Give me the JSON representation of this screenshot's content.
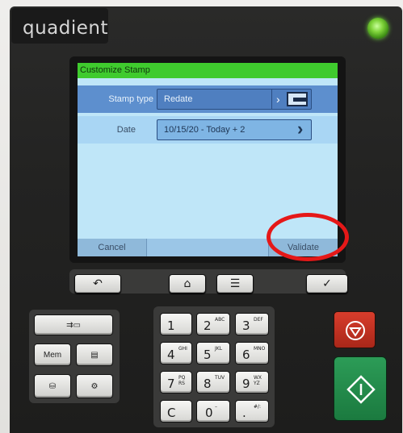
{
  "brand": {
    "logo_text": "quadient",
    "power_led_color": "#6fd23a"
  },
  "screen": {
    "title": "Customize Stamp",
    "title_bar_color": "#3fcb2e",
    "rows": [
      {
        "label": "Stamp type",
        "value": "Redate",
        "trailing_icon": "stamp-layout-icon"
      },
      {
        "label": "Date",
        "value": "10/15/20 - Today + 2",
        "trailing_icon": "chevron-right-icon"
      }
    ],
    "footer": {
      "cancel_label": "Cancel",
      "validate_label": "Validate"
    },
    "annotation_color": "#e51818"
  },
  "nav_buttons": [
    {
      "icon": "back-icon"
    },
    {
      "icon": "home-icon"
    },
    {
      "icon": "menu-icon"
    },
    {
      "icon": "checkmark-icon"
    }
  ],
  "side_keys": [
    {
      "icon": "feed-envelope-icon",
      "label": ""
    },
    {
      "icon": "",
      "label": "Mem"
    },
    {
      "icon": "card-slot-icon",
      "label": ""
    },
    {
      "icon": "coins-icon",
      "label": ""
    },
    {
      "icon": "postage-settings-icon",
      "label": ""
    }
  ],
  "keypad": [
    {
      "num": "1",
      "sub": ""
    },
    {
      "num": "2",
      "sub": "ABC"
    },
    {
      "num": "3",
      "sub": "DEF"
    },
    {
      "num": "4",
      "sub": "GHI"
    },
    {
      "num": "5",
      "sub": "JKL"
    },
    {
      "num": "6",
      "sub": "MNO"
    },
    {
      "num": "7",
      "sub": "PQ RS"
    },
    {
      "num": "8",
      "sub": "TUV"
    },
    {
      "num": "9",
      "sub": "WX YZ"
    },
    {
      "num": "C",
      "sub": ""
    },
    {
      "num": "0",
      "sub": "–"
    },
    {
      "num": ".",
      "sub": "#/:"
    }
  ],
  "action_buttons": {
    "stop": {
      "icon": "stop-icon",
      "color": "#d83d2c"
    },
    "start": {
      "icon": "start-icon",
      "color": "#2c9c57"
    }
  }
}
